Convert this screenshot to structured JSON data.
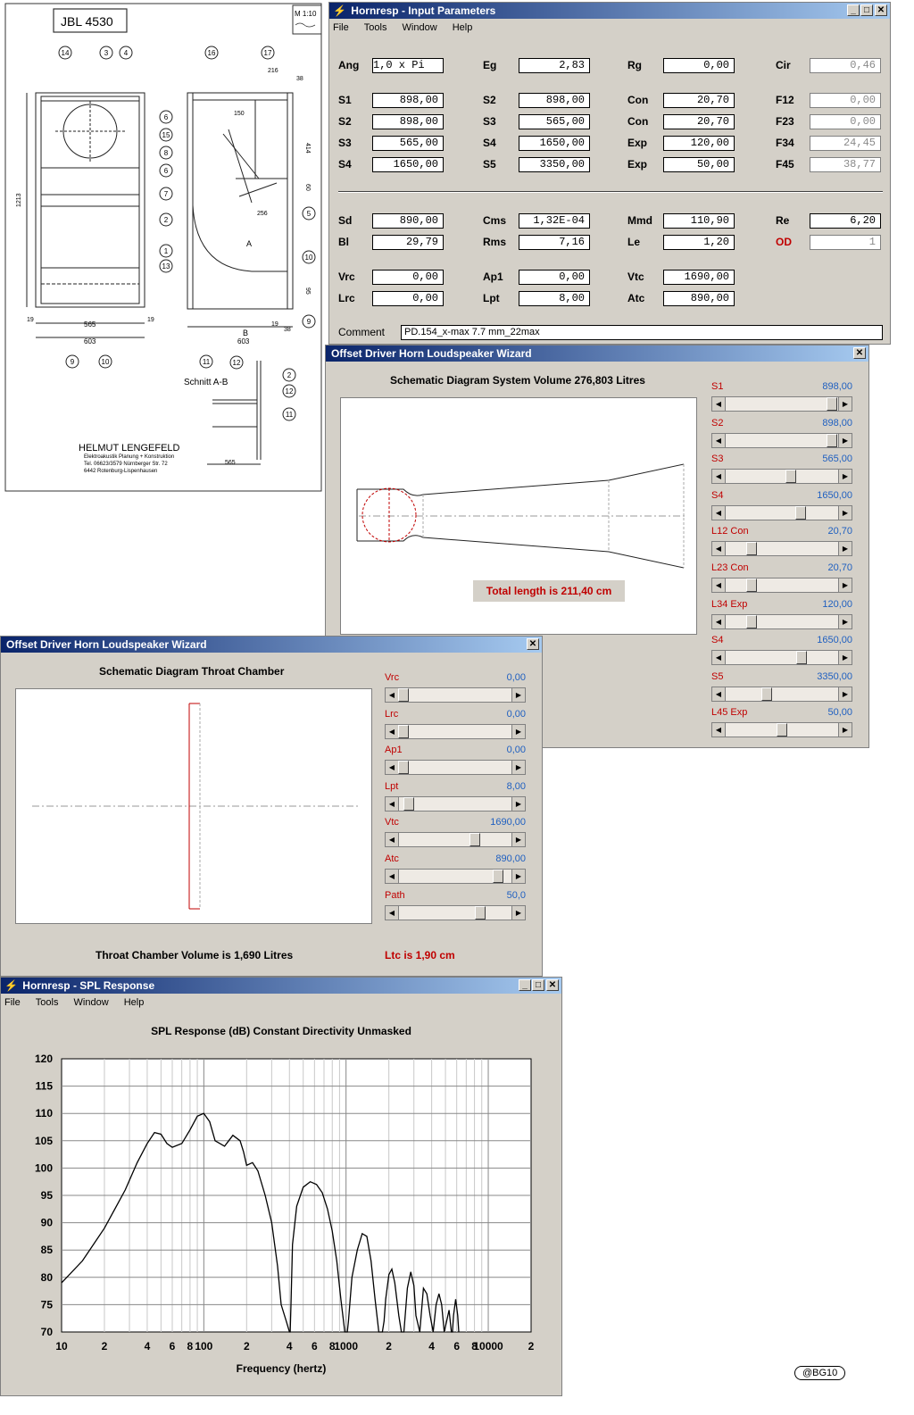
{
  "drawing": {
    "model": "JBL 4530",
    "scale": "M 1:10",
    "signature": "HELMUT LENGEFELD",
    "address": [
      "Elektroakustik Planung + Konstruktion",
      "Tel. 06623/3579 Nürnberger Str. 72",
      "6442 Rotenburg-Lispenhausen"
    ],
    "section_label": "Schnitt A-B",
    "dims": {
      "d565": "565",
      "d603": "603",
      "d19": "19",
      "d1213": "1213",
      "d216": "216",
      "d38": "38",
      "d150": "150",
      "d256": "256",
      "d414": "414",
      "d60": "60",
      "d95": "95",
      "d603b": "603",
      "d565b": "565"
    },
    "callouts": [
      "14",
      "3",
      "4",
      "16",
      "17",
      "6",
      "15",
      "8",
      "6",
      "7",
      "5",
      "2",
      "1",
      "13",
      "10",
      "9",
      "9",
      "10",
      "11",
      "12",
      "2",
      "12",
      "11"
    ],
    "markers": {
      "a": "A",
      "b": "B"
    }
  },
  "input_params": {
    "title": "Hornresp - Input Parameters",
    "menu": [
      "File",
      "Tools",
      "Window",
      "Help"
    ],
    "fields": [
      {
        "label": "Ang",
        "value": "1,0 x Pi"
      },
      {
        "label": "Eg",
        "value": "2,83"
      },
      {
        "label": "Rg",
        "value": "0,00"
      },
      {
        "label": "Cir",
        "value": "0,46"
      },
      {
        "label": "S1",
        "value": "898,00"
      },
      {
        "label": "S2",
        "value": "898,00"
      },
      {
        "label": "Con",
        "value": "20,70"
      },
      {
        "label": "F12",
        "value": "0,00"
      },
      {
        "label": "S2",
        "value": "898,00"
      },
      {
        "label": "S3",
        "value": "565,00"
      },
      {
        "label": "Con",
        "value": "20,70"
      },
      {
        "label": "F23",
        "value": "0,00"
      },
      {
        "label": "S3",
        "value": "565,00"
      },
      {
        "label": "S4",
        "value": "1650,00"
      },
      {
        "label": "Exp",
        "value": "120,00"
      },
      {
        "label": "F34",
        "value": "24,45"
      },
      {
        "label": "S4",
        "value": "1650,00"
      },
      {
        "label": "S5",
        "value": "3350,00"
      },
      {
        "label": "Exp",
        "value": "50,00"
      },
      {
        "label": "F45",
        "value": "38,77"
      },
      {
        "label": "Sd",
        "value": "890,00"
      },
      {
        "label": "Cms",
        "value": "1,32E-04"
      },
      {
        "label": "Mmd",
        "value": "110,90"
      },
      {
        "label": "Re",
        "value": "6,20"
      },
      {
        "label": "Bl",
        "value": "29,79"
      },
      {
        "label": "Rms",
        "value": "7,16"
      },
      {
        "label": "Le",
        "value": "1,20"
      },
      {
        "label": "OD",
        "value": "1"
      },
      {
        "label": "Vrc",
        "value": "0,00"
      },
      {
        "label": "Ap1",
        "value": "0,00"
      },
      {
        "label": "Vtc",
        "value": "1690,00"
      },
      {
        "label": "Lrc",
        "value": "0,00"
      },
      {
        "label": "Lpt",
        "value": "8,00"
      },
      {
        "label": "Atc",
        "value": "890,00"
      }
    ],
    "comment_label": "Comment",
    "comment_value": "PD.154_x-max 7.7 mm_22max"
  },
  "wizard1": {
    "title": "Offset Driver Horn Loudspeaker Wizard",
    "header": "Schematic Diagram   System Volume 276,803 Litres",
    "total_length": "Total length is 211,40 cm",
    "sliders": [
      {
        "name": "S1",
        "value": "898,00",
        "pos": 0.97
      },
      {
        "name": "S2",
        "value": "898,00",
        "pos": 0.97
      },
      {
        "name": "S3",
        "value": "565,00",
        "pos": 0.58
      },
      {
        "name": "S4",
        "value": "1650,00",
        "pos": 0.67
      },
      {
        "name": "L12  Con",
        "value": "20,70",
        "pos": 0.2
      },
      {
        "name": "L23  Con",
        "value": "20,70",
        "pos": 0.2
      },
      {
        "name": "L34  Exp",
        "value": "120,00",
        "pos": 0.2
      },
      {
        "name": "S4",
        "value": "1650,00",
        "pos": 0.68
      },
      {
        "name": "S5",
        "value": "3350,00",
        "pos": 0.35
      },
      {
        "name": "L45  Exp",
        "value": "50,00",
        "pos": 0.49
      }
    ]
  },
  "wizard2": {
    "title": "Offset Driver Horn Loudspeaker Wizard",
    "header": "Schematic Diagram   Throat Chamber",
    "volume": "Throat Chamber Volume is 1,690 Litres",
    "ltc": "Ltc is 1,90 cm",
    "sliders": [
      {
        "name": "Vrc",
        "value": "0,00",
        "pos": 0.0
      },
      {
        "name": "Lrc",
        "value": "0,00",
        "pos": 0.0
      },
      {
        "name": "Ap1",
        "value": "0,00",
        "pos": 0.0
      },
      {
        "name": "Lpt",
        "value": "8,00",
        "pos": 0.05
      },
      {
        "name": "Vtc",
        "value": "1690,00",
        "pos": 0.68
      },
      {
        "name": "Atc",
        "value": "890,00",
        "pos": 0.9
      },
      {
        "name": "Path",
        "value": "50,0",
        "pos": 0.73
      }
    ]
  },
  "spl": {
    "title": "Hornresp - SPL Response",
    "menu": [
      "File",
      "Tools",
      "Window",
      "Help"
    ],
    "chart_title": "SPL Response (dB)    Constant Directivity    Unmasked",
    "xlabel": "Frequency (hertz)",
    "ytick_labels": [
      "120",
      "115",
      "110",
      "105",
      "100",
      "95",
      "90",
      "85",
      "80",
      "75",
      "70"
    ],
    "xtick_labels": [
      {
        "f": 10,
        "t": "10"
      },
      {
        "f": 20,
        "t": "2"
      },
      {
        "f": 40,
        "t": "4"
      },
      {
        "f": 60,
        "t": "6"
      },
      {
        "f": 80,
        "t": "8"
      },
      {
        "f": 100,
        "t": "100"
      },
      {
        "f": 200,
        "t": "2"
      },
      {
        "f": 400,
        "t": "4"
      },
      {
        "f": 600,
        "t": "6"
      },
      {
        "f": 800,
        "t": "8"
      },
      {
        "f": 1000,
        "t": "1000"
      },
      {
        "f": 2000,
        "t": "2"
      },
      {
        "f": 4000,
        "t": "4"
      },
      {
        "f": 6000,
        "t": "6"
      },
      {
        "f": 8000,
        "t": "8"
      },
      {
        "f": 10000,
        "t": "10000"
      },
      {
        "f": 20000,
        "t": "2"
      }
    ]
  },
  "chart_data": {
    "type": "line",
    "title": "SPL Response (dB)    Constant Directivity    Unmasked",
    "xlabel": "Frequency (hertz)",
    "ylabel": "",
    "xscale": "log",
    "xlim": [
      10,
      20000
    ],
    "ylim": [
      70,
      120
    ],
    "grid": true,
    "series": [
      {
        "x": [
          10,
          14,
          20,
          28,
          34,
          40,
          45,
          50,
          55,
          60,
          70,
          80,
          90,
          100,
          110,
          120,
          140,
          160,
          180,
          190,
          200,
          220,
          240,
          270,
          300,
          330,
          350,
          380,
          400,
          405,
          410,
          420,
          450,
          500,
          560,
          620,
          680,
          740,
          800,
          860,
          920,
          980,
          1020,
          1040,
          1100,
          1200,
          1300,
          1400,
          1500,
          1600,
          1700,
          1800,
          1850,
          1900,
          2000,
          2100,
          2200,
          2350,
          2450,
          2550,
          2700,
          2850,
          3000,
          3100,
          3300,
          3500,
          3700,
          3900,
          4100,
          4300,
          4500,
          4700,
          4900,
          5100,
          5300,
          5500,
          5600,
          5700,
          5900,
          6100,
          6200
        ],
        "y": [
          79,
          83,
          89,
          96,
          101,
          104.5,
          106.5,
          106.2,
          104.5,
          103.8,
          104.5,
          107,
          109.5,
          110,
          108.5,
          105,
          104,
          106,
          105,
          103,
          100.5,
          101,
          99.5,
          95,
          90,
          82,
          75,
          72,
          70,
          70,
          75,
          86,
          93,
          96.5,
          97.5,
          97,
          95.5,
          92.5,
          88.5,
          83,
          76,
          70,
          70,
          72,
          80,
          85,
          88,
          87.5,
          83,
          76,
          70,
          70,
          72,
          76,
          80.5,
          81.5,
          79,
          73,
          70,
          70,
          78,
          81,
          78.5,
          73,
          70,
          78,
          77,
          73,
          70,
          75,
          77,
          75,
          70,
          72,
          74,
          70,
          70,
          73,
          76,
          73,
          70
        ]
      }
    ]
  }
}
